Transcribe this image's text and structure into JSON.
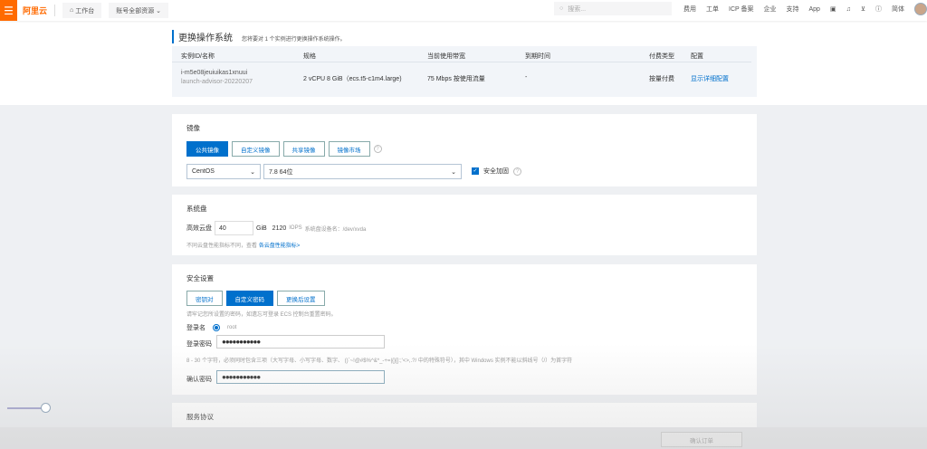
{
  "header": {
    "brand": "阿里云",
    "workbench": "工作台",
    "resources": "账号全部资源",
    "search_placeholder": "搜索...",
    "nav": [
      "费用",
      "工单",
      "ICP 备案",
      "企业",
      "支持",
      "App"
    ],
    "lang": "简体"
  },
  "page": {
    "title": "更换操作系统",
    "subtitle": "您将要对 1 个实例进行更换操作系统操作。"
  },
  "table": {
    "headers": [
      "实例ID/名称",
      "规格",
      "当前使用带宽",
      "到期时间",
      "付费类型",
      "配置"
    ],
    "row": {
      "id": "i-m5e08jeuiuikas1xnuui",
      "name": "launch-advisor-20220207",
      "spec": "2 vCPU 8 GiB（ecs.t5-c1m4.large)",
      "bandwidth": "75 Mbps 按使用流量",
      "expire": "-",
      "pay": "按量付费",
      "config": "显示详细配置"
    }
  },
  "image": {
    "label": "镜像",
    "tabs": [
      "公共镜像",
      "自定义镜像",
      "共享镜像",
      "镜像市场"
    ],
    "os": "CentOS",
    "version": "7.8 64位",
    "security": "安全加固",
    "security_checked": true
  },
  "disk": {
    "label": "系统盘",
    "type": "高效云盘",
    "size": "40",
    "unit": "GiB",
    "iops": "2120",
    "iops_label": "IOPS",
    "device": "系统盘设备名：/dev/xvda",
    "note": "不同云盘性能指标不同，查看",
    "note_link": "各云盘性能指标>"
  },
  "security": {
    "label": "安全设置",
    "tabs": [
      "密钥对",
      "自定义密码",
      "更换后设置"
    ],
    "hint": "请牢记您所设置的密码，如遗忘可登录 ECS 控制台重置密码。",
    "login_label": "登录名",
    "login_value": "root",
    "pwd_label": "登录密码",
    "pwd": "●●●●●●●●●●●",
    "rule": "8 - 30 个字符，必须同时包含三项（大写字母、小写字母、数字、 ()`~!@#$%^&*_-+=|{}[]:;'<>,.?/ 中的特殊符号），其中 Windows 实例不能以斜线号（/）为首字符",
    "confirm_label": "确认密码",
    "confirm": "●●●●●●●●●●●"
  },
  "service": {
    "label": "服务协议"
  },
  "footer": {
    "confirm": "确认订单"
  }
}
